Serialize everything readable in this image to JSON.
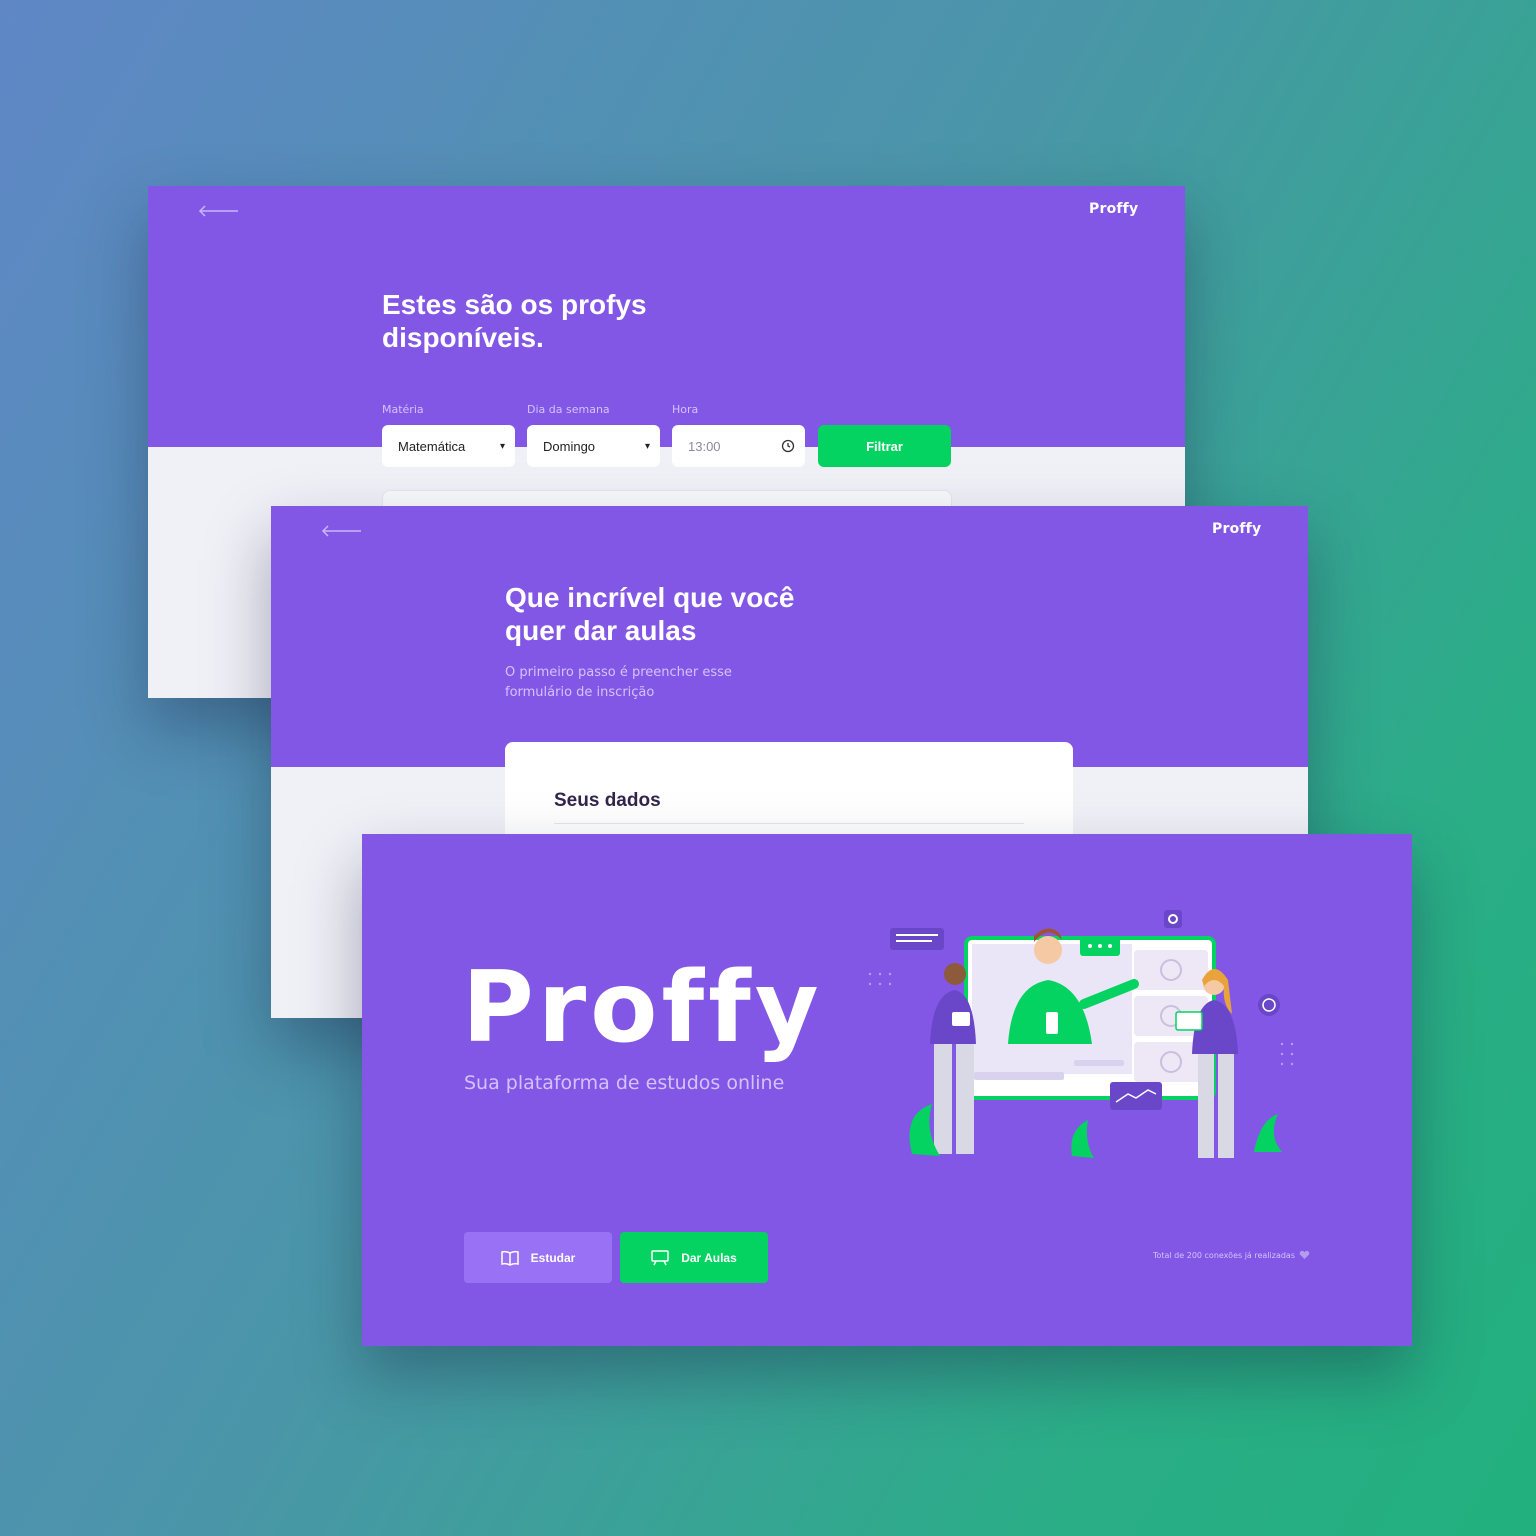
{
  "screen_search": {
    "logo": "Proffy",
    "title": "Estes são os profys disponíveis.",
    "filters": {
      "subject": {
        "label": "Matéria",
        "value": "Matemática"
      },
      "weekday": {
        "label": "Dia da semana",
        "value": "Domingo"
      },
      "time": {
        "label": "Hora",
        "value": "13:00"
      },
      "submit_label": "Filtrar"
    }
  },
  "screen_form": {
    "logo": "Proffy",
    "title": "Que incrível que você quer dar aulas",
    "subtitle": "O primeiro passo é preencher esse formulário de inscrição",
    "section_title": "Seus dados"
  },
  "screen_landing": {
    "logo": "Proffy",
    "tagline": "Sua plataforma de estudos online",
    "buttons": {
      "study": {
        "label": "Estudar",
        "icon": "book-icon"
      },
      "give_classes": {
        "label": "Dar Aulas",
        "icon": "presentation-icon"
      }
    },
    "connections_text": "Total de 200 conexões já realizadas"
  },
  "colors": {
    "primary": "#8257e5",
    "primary_light": "#9871f5",
    "secondary": "#04d361",
    "background": "#f0f0f7",
    "text_on_primary": "#d4c2ff",
    "title_dark": "#32264d"
  }
}
